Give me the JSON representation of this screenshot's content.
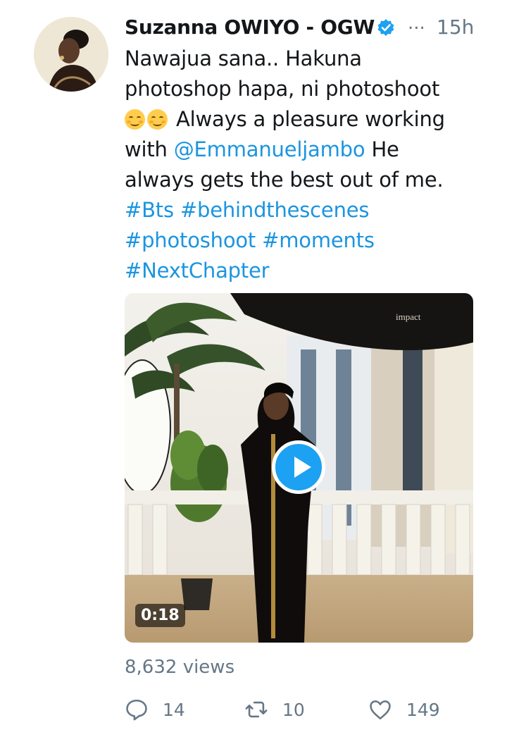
{
  "tweet": {
    "author_name": "Suzanna OWIYO - OGW",
    "more_label": "...",
    "time": "15h",
    "text": {
      "line1": "Nawajua sana.. Hakuna",
      "line2": "photoshop hapa, ni photoshoot",
      "line3_text": "Always a pleasure working",
      "line4_prefix": "with ",
      "mention": "@Emmanueljambo",
      "line4_suffix": " He",
      "line5": "always gets the best out of me.",
      "hashtags_line1": [
        "#Bts",
        "#behindthescenes"
      ],
      "hashtags_line2": [
        "#photoshoot",
        "#moments"
      ],
      "hashtags_line3": [
        "#NextChapter"
      ]
    },
    "video": {
      "duration": "0:18",
      "brand_sign": "impact"
    },
    "views": "8,632 views",
    "actions": {
      "replies": "14",
      "retweets": "10",
      "likes": "149"
    }
  },
  "colors": {
    "link": "#1b95e0",
    "verified": "#1da1f2",
    "muted": "#657786"
  },
  "icons": [
    "verified-badge-icon",
    "smiling-face-emoji",
    "play-icon",
    "reply-icon",
    "retweet-icon",
    "like-heart-icon"
  ]
}
